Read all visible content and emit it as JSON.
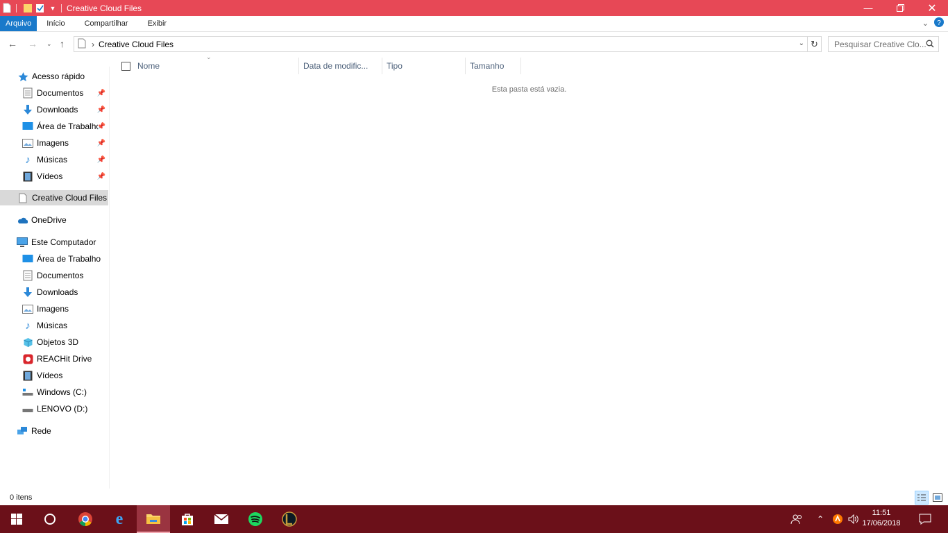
{
  "window": {
    "title": "Creative Cloud Files"
  },
  "ribbon": {
    "tabs": [
      "Arquivo",
      "Início",
      "Compartilhar",
      "Exibir"
    ]
  },
  "address": {
    "path": "Creative Cloud Files",
    "separator": "›"
  },
  "search": {
    "placeholder": "Pesquisar Creative Clo..."
  },
  "columns": [
    "Nome",
    "Data de modific...",
    "Tipo",
    "Tamanho"
  ],
  "content": {
    "empty_message": "Esta pasta está vazia."
  },
  "sidebar": {
    "quick_access": "Acesso rápido",
    "quick_items": [
      "Documentos",
      "Downloads",
      "Área de Trabalho",
      "Imagens",
      "Músicas",
      "Vídeos"
    ],
    "creative_cloud": "Creative Cloud Files",
    "onedrive": "OneDrive",
    "this_pc": "Este Computador",
    "pc_items": [
      "Área de Trabalho",
      "Documentos",
      "Downloads",
      "Imagens",
      "Músicas",
      "Objetos 3D",
      "REACHit Drive",
      "Vídeos",
      "Windows (C:)",
      "LENOVO (D:)"
    ],
    "network": "Rede"
  },
  "status": {
    "items_count": "0 itens"
  },
  "taskbar": {
    "time": "11:51",
    "date": "17/06/2018"
  },
  "colors": {
    "titlebar": "#e74856",
    "taskbar": "#6b1019",
    "accent": "#1979ca"
  }
}
